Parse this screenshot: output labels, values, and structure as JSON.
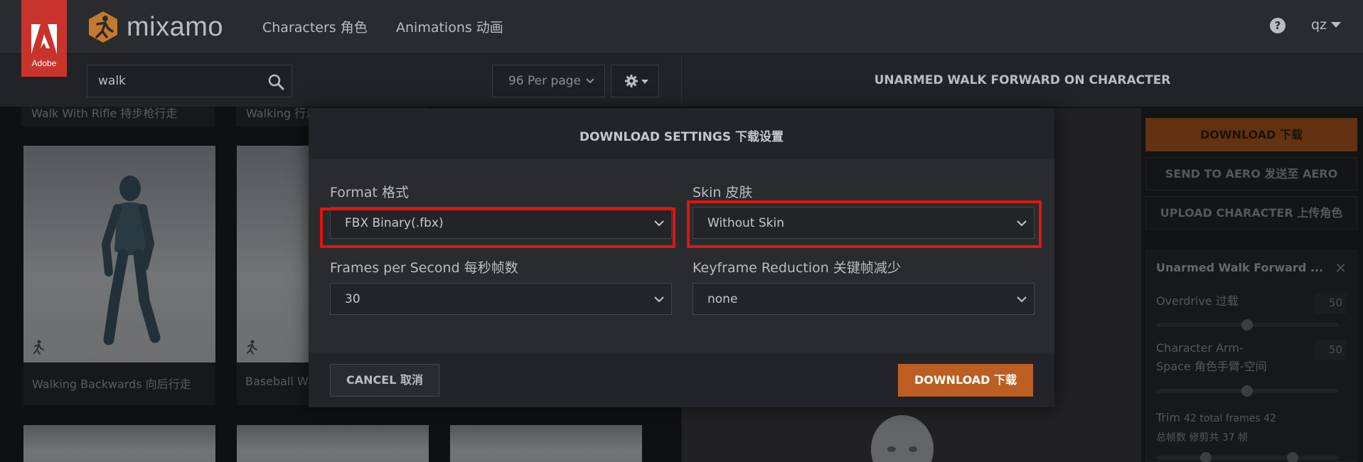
{
  "header": {
    "adobe_text": "Adobe",
    "brand": "mixamo",
    "nav": [
      {
        "label": "Characters 角色"
      },
      {
        "label": "Animations 动画"
      }
    ],
    "help": "?",
    "user": "qz"
  },
  "toolbar": {
    "search_value": "walk",
    "per_page": "96 Per page"
  },
  "grid": {
    "top_row": [
      "Walk With Rifle 持步枪行走",
      "Walking 行走"
    ],
    "cards": [
      {
        "label": "Walking Backwards 向后行走"
      },
      {
        "label": "Baseball Walk"
      }
    ]
  },
  "preview": {
    "title": "UNARMED WALK FORWARD ON CHARACTER"
  },
  "side": {
    "download_label": "DOWNLOAD 下载",
    "send_label": "SEND TO AERO 发送至 AERO",
    "upload_label": "UPLOAD CHARACTER 上传角色",
    "panel_title": "Unarmed Walk Forward ...",
    "overdrive_label": "Overdrive 过载",
    "overdrive_value": "50",
    "overdrive_fraction": 0.5,
    "armspace_label_1": "Character Arm-",
    "armspace_label_2": "Space 角色手臂-空间",
    "armspace_value": "50",
    "armspace_fraction": 0.5,
    "trim_label_1": "Trim",
    "trim_label_small": "42 total frames 42",
    "trim_label_2": "总帧数 修剪共 37 帧"
  },
  "modal": {
    "title": "DOWNLOAD SETTINGS 下载设置",
    "format_label": "Format 格式",
    "format_value": "FBX Binary(.fbx)",
    "skin_label": "Skin 皮肤",
    "skin_value": "Without Skin",
    "fps_label": "Frames per Second 每秒帧数",
    "fps_value": "30",
    "keyframe_label": "Keyframe Reduction 关键帧减少",
    "keyframe_value": "none",
    "cancel_label": "CANCEL 取消",
    "download_label": "DOWNLOAD 下载"
  },
  "colors": {
    "accent": "#bc5e22",
    "highlight": "#e1150e",
    "adobe_red": "#c8342b"
  }
}
